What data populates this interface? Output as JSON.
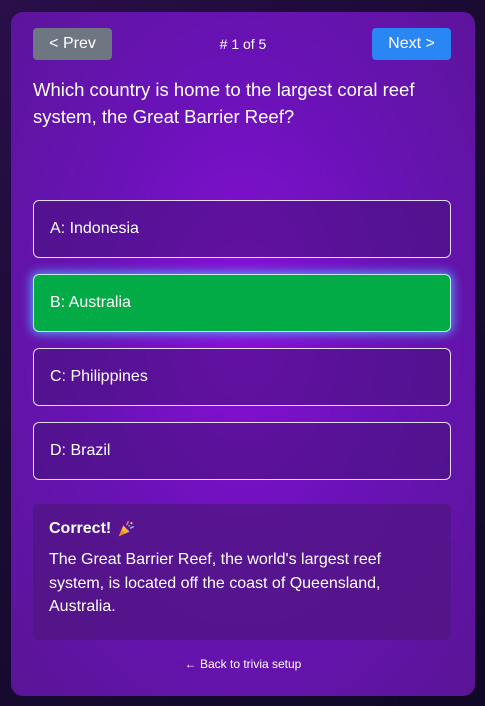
{
  "nav": {
    "prev_label": "< Prev",
    "next_label": "Next >",
    "counter": "# 1 of 5"
  },
  "question": "Which country is home to the largest coral reef system, the Great Barrier Reef?",
  "options": [
    {
      "label": "A: Indonesia",
      "state": "default"
    },
    {
      "label": "B: Australia",
      "state": "correct"
    },
    {
      "label": "C: Philippines",
      "state": "default"
    },
    {
      "label": "D: Brazil",
      "state": "default"
    }
  ],
  "feedback": {
    "title": "Correct!",
    "icon": "party-popper-icon",
    "text": "The Great Barrier Reef, the world's largest reef system, is located off the coast of Queensland, Australia."
  },
  "footer": {
    "back_label": "← Back to trivia setup"
  },
  "colors": {
    "correct": "#02ab45",
    "next_button": "#2b86f5",
    "prev_button": "#6e7681"
  }
}
